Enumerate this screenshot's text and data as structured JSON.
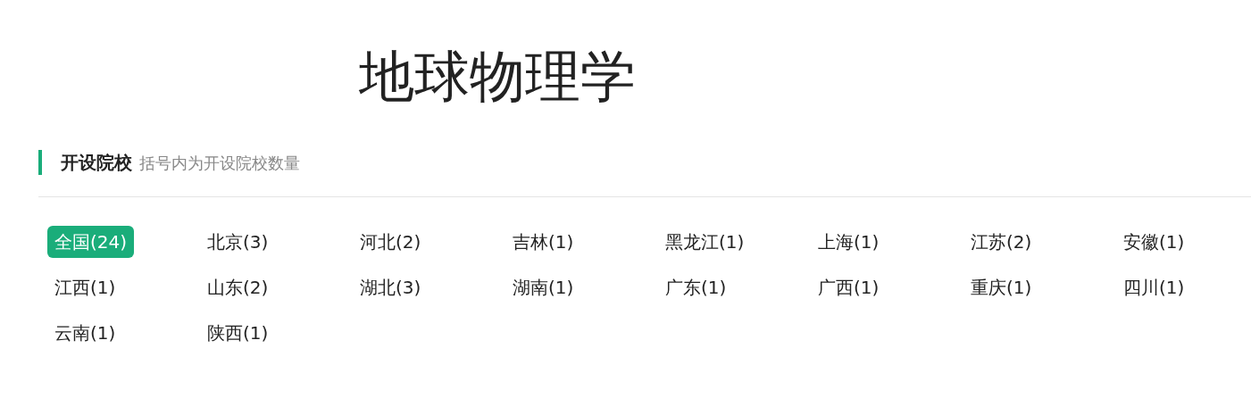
{
  "title": "地球物理学",
  "section": {
    "heading": "开设院校",
    "note": "括号内为开设院校数量"
  },
  "regions": [
    {
      "label": "全国(24)",
      "selected": true
    },
    {
      "label": "北京(3)",
      "selected": false
    },
    {
      "label": "河北(2)",
      "selected": false
    },
    {
      "label": "吉林(1)",
      "selected": false
    },
    {
      "label": "黑龙江(1)",
      "selected": false
    },
    {
      "label": "上海(1)",
      "selected": false
    },
    {
      "label": "江苏(2)",
      "selected": false
    },
    {
      "label": "安徽(1)",
      "selected": false
    },
    {
      "label": "江西(1)",
      "selected": false
    },
    {
      "label": "山东(2)",
      "selected": false
    },
    {
      "label": "湖北(3)",
      "selected": false
    },
    {
      "label": "湖南(1)",
      "selected": false
    },
    {
      "label": "广东(1)",
      "selected": false
    },
    {
      "label": "广西(1)",
      "selected": false
    },
    {
      "label": "重庆(1)",
      "selected": false
    },
    {
      "label": "四川(1)",
      "selected": false
    },
    {
      "label": "云南(1)",
      "selected": false
    },
    {
      "label": "陕西(1)",
      "selected": false
    }
  ]
}
